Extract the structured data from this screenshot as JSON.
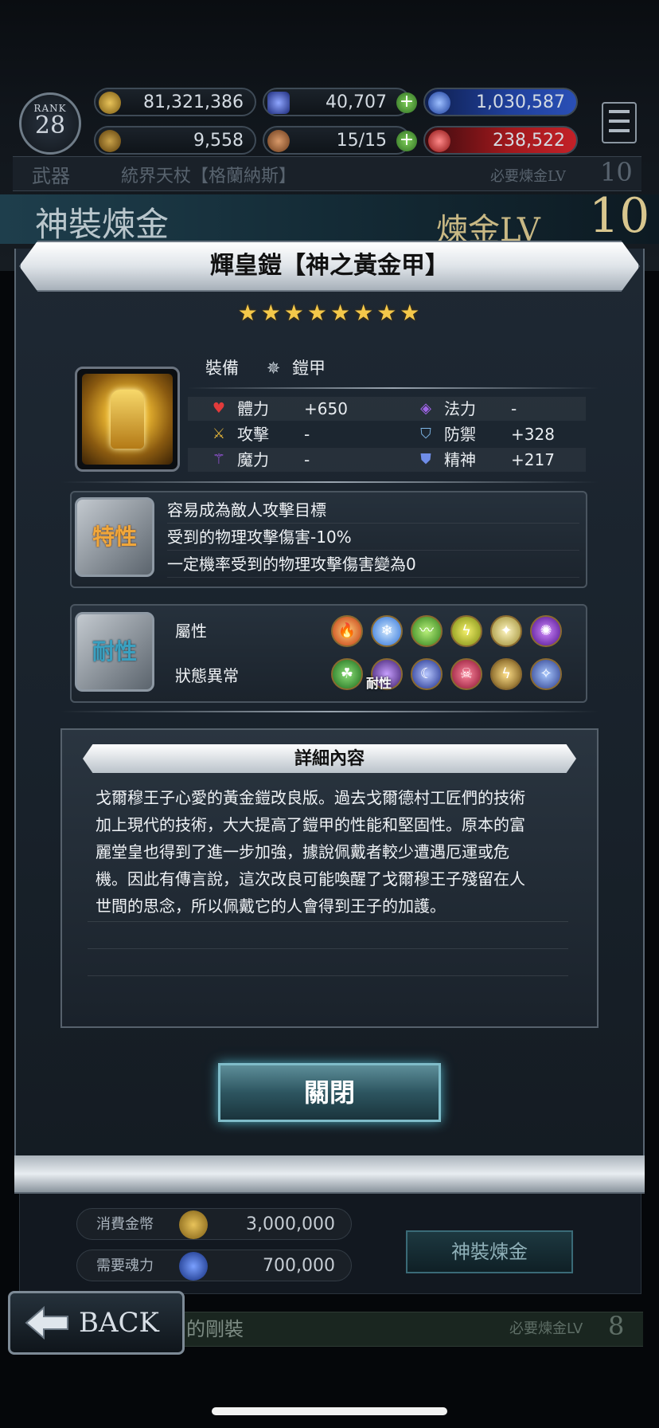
{
  "header": {
    "rank_label": "RANK",
    "rank_value": "28",
    "resources": {
      "gold": "81,321,386",
      "crystal": "40,707",
      "blue_orb": "1,030,587",
      "medal": "9,558",
      "stamina": "15/15",
      "red_orb": "238,522"
    }
  },
  "background": {
    "weapon_label": "武器",
    "weapon_name": "統界天杖【格蘭納斯】",
    "required_lv_label": "必要煉金LV",
    "required_lv_value": "10",
    "banner_title": "神裝煉金",
    "alchemy_lv_label": "煉金LV",
    "alchemy_lv_value": "10",
    "cost_gold_label": "消費金幣",
    "cost_gold_value": "3,000,000",
    "cost_soul_label": "需要魂力",
    "cost_soul_value": "700,000",
    "alchemy_button": "神裝煉金",
    "back_button": "BACK",
    "next_row_name": "的剛裝",
    "next_row_required_label": "必要煉金LV",
    "next_row_required_value": "8"
  },
  "modal": {
    "title": "輝皇鎧【神之黃金甲】",
    "stars": "★★★★★★★★",
    "equip_label": "裝備",
    "equip_type": "鎧甲",
    "stats": [
      {
        "icon": "heart-icon",
        "label": "體力",
        "value": "+650"
      },
      {
        "icon": "sword-icon",
        "label": "攻擊",
        "value": "-"
      },
      {
        "icon": "magic-wand-icon",
        "label": "魔力",
        "value": "-"
      },
      {
        "icon": "spell-icon",
        "label": "法力",
        "value": "-"
      },
      {
        "icon": "shield-icon",
        "label": "防禦",
        "value": "+328"
      },
      {
        "icon": "spirit-shield-icon",
        "label": "精神",
        "value": "+217"
      }
    ],
    "trait_badge": "特性",
    "traits": [
      "容易成為敵人攻擊目標",
      "受到的物理攻擊傷害-10%",
      "一定機率受到的物理攻擊傷害變為0"
    ],
    "resist_badge": "耐性",
    "attribute_label": "屬性",
    "status_label": "狀態異常",
    "resist_overlay": "耐性",
    "detail_title": "詳細內容",
    "description_lines": [
      "戈爾穆王子心愛的黃金鎧改良版。過去戈爾德村工匠們的技術",
      "加上現代的技術，大大提高了鎧甲的性能和堅固性。原本的富",
      "麗堂皇也得到了進一步加強，據說佩戴者較少遭遇厄運或危",
      "機。因此有傳言說，這次改良可能喚醒了戈爾穆王子殘留在人",
      "世間的思念，所以佩戴它的人會得到王子的加護。"
    ],
    "close_button": "關閉"
  }
}
